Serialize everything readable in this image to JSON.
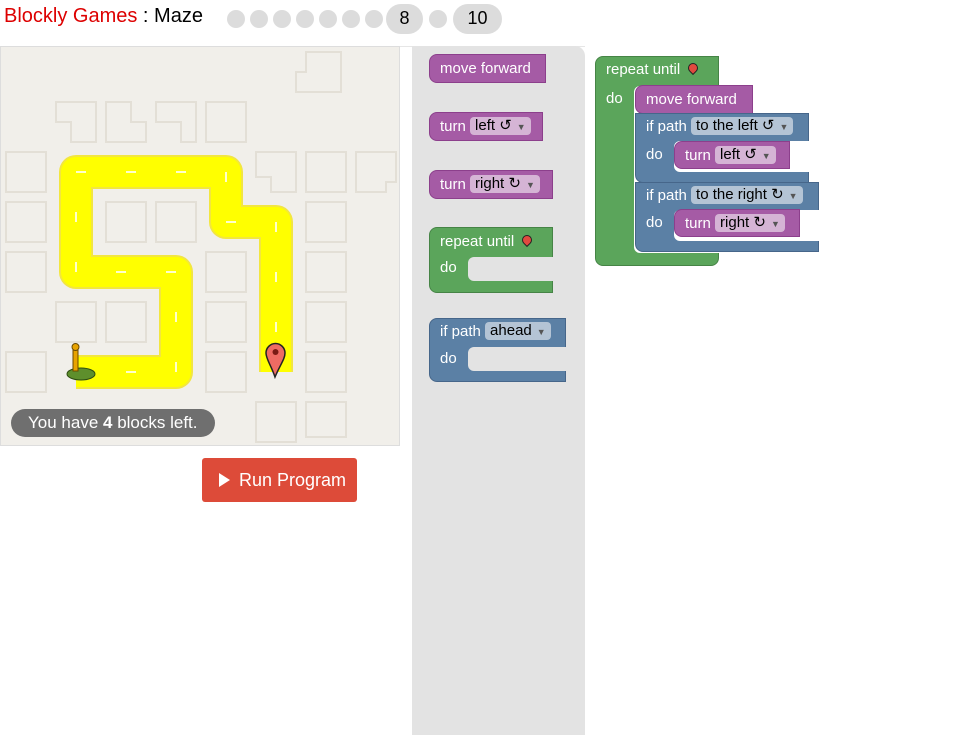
{
  "header": {
    "brand": "Blockly Games",
    "separator": " : ",
    "game": "Maze",
    "levels": [
      "1",
      "2",
      "3",
      "4",
      "5",
      "6",
      "7",
      "8",
      "9",
      "10"
    ],
    "current_level": "8",
    "last_level": "10"
  },
  "maze": {
    "blocks_left_prefix": "You have ",
    "blocks_left_count": "4",
    "blocks_left_suffix": " blocks left."
  },
  "run_button": {
    "label": "Run Program"
  },
  "toolbox": {
    "move_forward": "move forward",
    "turn_left": {
      "label": "turn",
      "value": "left ↺"
    },
    "turn_right": {
      "label": "turn",
      "value": "right ↻"
    },
    "repeat_until": {
      "label": "repeat until",
      "do": "do"
    },
    "if_path": {
      "label": "if path",
      "value": "ahead",
      "do": "do"
    }
  },
  "program": {
    "repeat_until": "repeat until",
    "do": "do",
    "move_forward": "move forward",
    "if_left": {
      "label": "if path",
      "value": "to the left ↺",
      "do": "do"
    },
    "turn_left": {
      "label": "turn",
      "value": "left ↺"
    },
    "if_right": {
      "label": "if path",
      "value": "to the right ↻",
      "do": "do"
    },
    "turn_right": {
      "label": "turn",
      "value": "right ↻"
    }
  },
  "colors": {
    "brand": "#dd0000",
    "run_button": "#dd4b39",
    "motion_blocks": "#a55ba5",
    "loop_blocks": "#5ba55b",
    "logic_blocks": "#5b80a5",
    "path": "#ffff00"
  },
  "icons": [
    "goal-marker-icon",
    "pegman-icon",
    "play-icon",
    "dropdown-arrow-icon",
    "turn-left-icon",
    "turn-right-icon"
  ]
}
